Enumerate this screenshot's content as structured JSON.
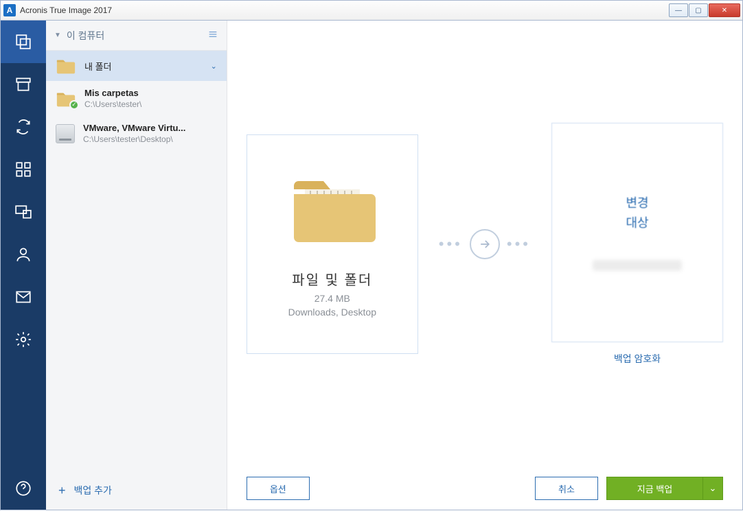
{
  "window": {
    "title": "Acronis True Image 2017",
    "icon_letter": "A"
  },
  "side": {
    "header": "이 컴퓨터",
    "items": [
      {
        "title": "내 폴더",
        "sub": "",
        "selected": true,
        "type": "folder"
      },
      {
        "title": "Mis carpetas",
        "sub": "C:\\Users\\tester\\",
        "selected": false,
        "type": "folder-ok"
      },
      {
        "title": "VMware, VMware Virtu...",
        "sub": "C:\\Users\\tester\\Desktop\\",
        "selected": false,
        "type": "disk"
      }
    ],
    "add_backup": "백업 추가"
  },
  "source": {
    "heading": "파일 및 폴더",
    "size": "27.4 MB",
    "detail": "Downloads, Desktop"
  },
  "dest": {
    "line1": "변경",
    "line2": "대상",
    "encrypt": "백업 암호화"
  },
  "footer": {
    "options": "옵션",
    "cancel": "취소",
    "backup_now": "지금 백업"
  }
}
